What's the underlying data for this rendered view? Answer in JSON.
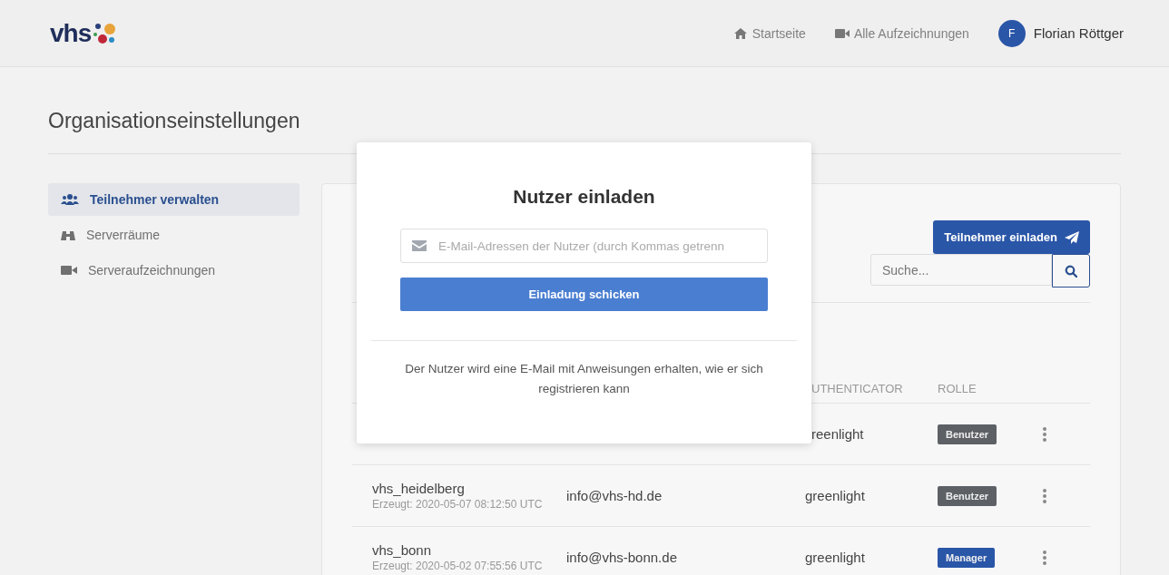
{
  "header": {
    "logo": "vhs",
    "nav": [
      {
        "kind": "home",
        "label": "Startseite"
      },
      {
        "kind": "video",
        "label": "Alle Aufzeichnungen"
      }
    ],
    "user": {
      "initial": "F",
      "name": "Florian Röttger"
    }
  },
  "page_title": "Organisationseinstellungen",
  "sidebar": {
    "items": [
      {
        "kind": "users",
        "label": "Teilnehmer verwalten",
        "selected": true
      },
      {
        "kind": "binoculars",
        "label": "Serverräume",
        "selected": false
      },
      {
        "kind": "video",
        "label": "Serveraufzeichnungen",
        "selected": false
      }
    ]
  },
  "panel": {
    "invite_button": "Teilnehmer einladen",
    "search": {
      "placeholder": "Suche..."
    },
    "table": {
      "columns": [
        "UTHENTICATOR",
        "ROLLE"
      ],
      "rows": [
        {
          "authenticator": "reenlight",
          "role": {
            "kind": "user",
            "label": "Benutzer"
          }
        },
        {
          "name": "vhs_heidelberg",
          "created": "Erzeugt: 2020-05-07 08:12:50 UTC",
          "email": "info@vhs-hd.de",
          "authenticator": "greenlight",
          "role": {
            "kind": "user",
            "label": "Benutzer"
          }
        },
        {
          "name": "vhs_bonn",
          "created": "Erzeugt: 2020-05-02 07:55:56 UTC",
          "email": "info@vhs-bonn.de",
          "authenticator": "greenlight",
          "role": {
            "kind": "manager",
            "label": "Manager"
          }
        }
      ]
    }
  },
  "modal": {
    "title": "Nutzer einladen",
    "email_field": {
      "placeholder": "E-Mail-Adressen der Nutzer (durch Kommas getrenn"
    },
    "submit": "Einladung schicken",
    "note": "Der Nutzer wird eine E-Mail mit Anweisungen erhalten, wie er sich registrieren kann"
  }
}
